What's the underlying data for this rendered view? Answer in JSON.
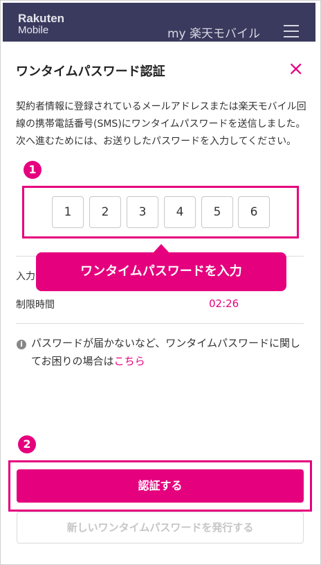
{
  "header": {
    "logo_line1": "Rakuten",
    "logo_line2": "Mobile",
    "my_link": "my 楽天モバイル"
  },
  "modal": {
    "title": "ワンタイムパスワード認証",
    "description": "契約者情報に登録されているメールアドレスまたは楽天モバイル回線の携帯電話番号(SMS)にワンタイムパスワードを送信しました。次へ進むためには、お送りしたパスワードを入力してください。",
    "otp_digits": [
      "1",
      "2",
      "3",
      "4",
      "5",
      "6"
    ],
    "input_label": "入力",
    "timer_label": "制限時間",
    "timer_value": "02:26",
    "info_text": "パスワードが届かないなど、ワンタイムパスワードに関してお困りの場合は",
    "info_link": "こちら",
    "submit_label": "認証する",
    "resend_label": "新しいワンタイムパスワードを発行する"
  },
  "annotations": {
    "step1": "1",
    "step2": "2",
    "callout": "ワンタイムパスワードを入力"
  },
  "colors": {
    "accent": "#e5007e",
    "header_bg": "#3a3a5e"
  },
  "icons": {
    "menu": "hamburger-menu-icon",
    "close": "close-icon",
    "info": "info-icon"
  }
}
